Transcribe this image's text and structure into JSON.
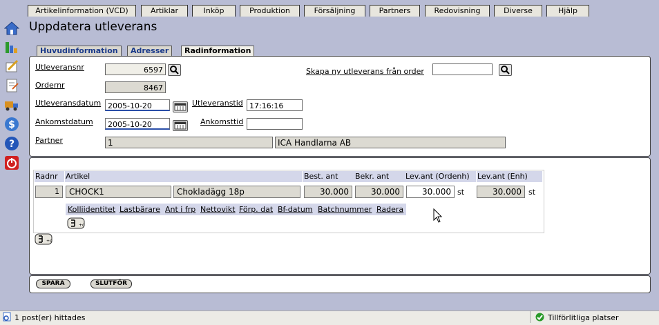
{
  "menu": [
    "Artikelinformation (VCD)",
    "Artiklar",
    "Inköp",
    "Produktion",
    "Försäljning",
    "Partners",
    "Redovisning",
    "Diverse",
    "Hjälp"
  ],
  "page_title": "Uppdatera utleverans",
  "tabs": [
    "Huvudinformation",
    "Adresser",
    "Radinformation"
  ],
  "form": {
    "utleveransnr_label": "Utleveransnr",
    "utleveransnr": "6597",
    "skapa_label": "Skapa ny utleverans från order",
    "skapa_value": "",
    "ordernr_label": "Ordernr",
    "ordernr": "8467",
    "utleveransdatum_label": "Utleveransdatum",
    "utleveransdatum": "2005-10-20",
    "utleveranstid_label": "Utleveranstid",
    "utleveranstid": "17:16:16",
    "ankomstdatum_label": "Ankomstdatum",
    "ankomstdatum": "2005-10-20",
    "ankomsttid_label": "Ankomsttid",
    "ankomsttid": "",
    "partner_label": "Partner",
    "partner_id": "1",
    "partner_name": "ICA Handlarna AB"
  },
  "grid": {
    "headers": [
      "Radnr",
      "Artikel",
      "Best. ant",
      "Bekr. ant",
      "Lev.ant (Ordenh)",
      "Lev.ant (Enh)"
    ],
    "row": {
      "radnr": "1",
      "artikel": "CHOCK1",
      "beskrivning": "Chokladägg 18p",
      "best": "30.000",
      "bekr": "30.000",
      "lev_ordenh": "30.000",
      "unit1": "st",
      "lev_enh": "30.000",
      "unit2": "st"
    },
    "sub_headers": [
      "Kolliidentitet",
      "Lastbärare",
      "Ant i frp",
      "Nettovikt",
      "Förp. dat",
      "Bf-datum",
      "Batchnummer",
      "Radera"
    ]
  },
  "buttons": {
    "spara": "SPARA",
    "slutfor": "SLUTFÖR"
  },
  "status": {
    "left": "1 post(er) hittades",
    "right": "Tillförlitliga platser"
  }
}
